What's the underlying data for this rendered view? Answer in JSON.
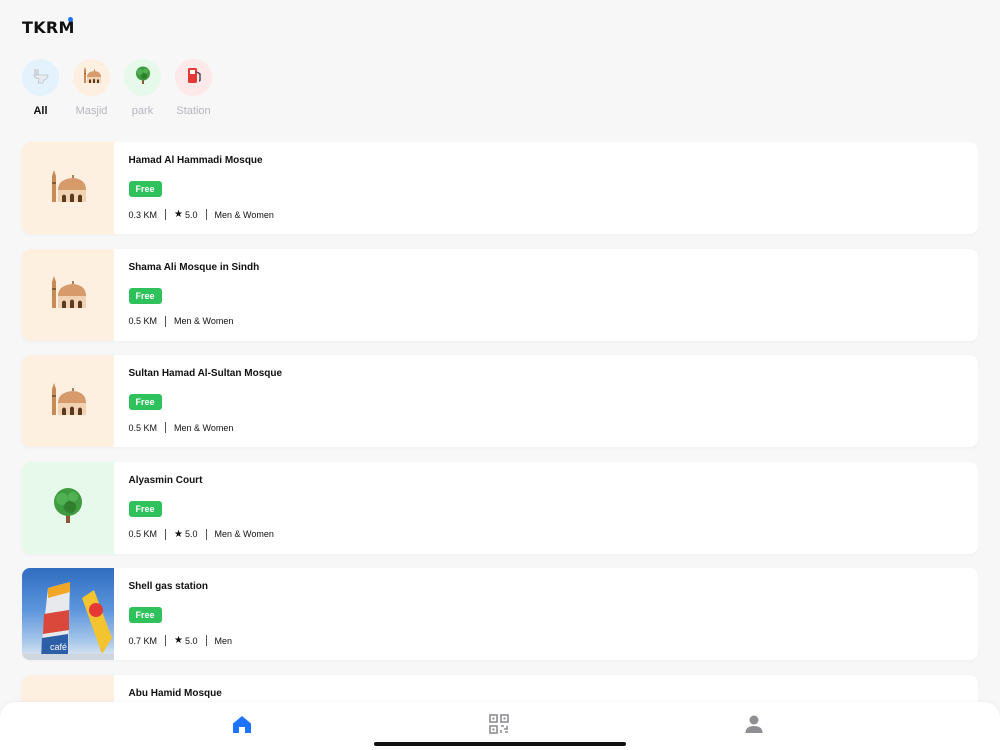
{
  "app": {
    "logo": "TKRM"
  },
  "categories": [
    {
      "label": "All",
      "icon": "toilet-icon",
      "bg": "#e3f2fd",
      "active": true
    },
    {
      "label": "Masjid",
      "icon": "mosque-icon",
      "bg": "#fdf0e1"
    },
    {
      "label": "park",
      "icon": "tree-icon",
      "bg": "#e6f9ea"
    },
    {
      "label": "Station",
      "icon": "fuel-pump-icon",
      "bg": "#fde8ea"
    }
  ],
  "places": [
    {
      "name": "Hamad Al Hammadi Mosque",
      "badge": "Free",
      "distance": "0.3 KM",
      "rating": "5.0",
      "gender": "Men & Women",
      "icon": "mosque-icon",
      "bg": "#fdf0e1"
    },
    {
      "name": "Shama Ali Mosque in Sindh",
      "badge": "Free",
      "distance": "0.5 KM",
      "rating": "",
      "gender": "Men & Women",
      "icon": "mosque-icon",
      "bg": "#fdf0e1"
    },
    {
      "name": "Sultan Hamad Al-Sultan Mosque",
      "badge": "Free",
      "distance": "0.5 KM",
      "rating": "",
      "gender": "Men & Women",
      "icon": "mosque-icon",
      "bg": "#fdf0e1"
    },
    {
      "name": "Alyasmin Court",
      "badge": "Free",
      "distance": "0.5 KM",
      "rating": "5.0",
      "gender": "Men & Women",
      "icon": "tree-icon",
      "bg": "#e6f9ea"
    },
    {
      "name": "Shell gas station",
      "badge": "Free",
      "distance": "0.7 KM",
      "rating": "5.0",
      "gender": "Men",
      "icon": "gas-station-photo",
      "bg": "#3a76c8",
      "photo_text": "café"
    },
    {
      "name": "Abu Hamid Mosque",
      "badge": "",
      "distance": "",
      "rating": "",
      "gender": "",
      "icon": "mosque-icon",
      "bg": "#fdf0e1"
    }
  ],
  "tabs": [
    {
      "name": "tab-home",
      "icon": "home-icon",
      "active": true
    },
    {
      "name": "tab-scan",
      "icon": "qr-code-icon"
    },
    {
      "name": "tab-profile",
      "icon": "user-icon"
    }
  ],
  "colors": {
    "accent": "#1e73ff",
    "free_badge": "#2fc15b"
  }
}
